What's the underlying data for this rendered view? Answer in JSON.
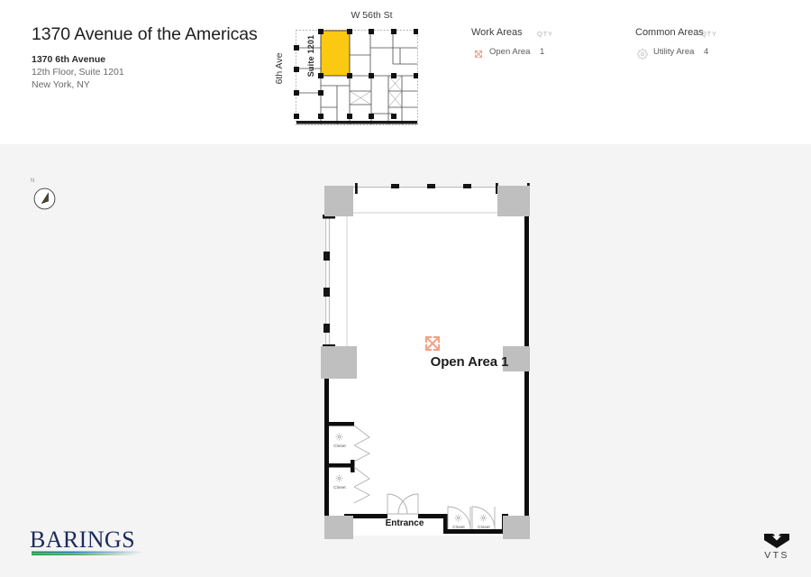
{
  "header": {
    "building_title": "1370 Avenue of the Americas",
    "address_line_1": "1370 6th Avenue",
    "address_line_2": "12th Floor, Suite 1201",
    "address_line_3": "New York, NY"
  },
  "key_plan": {
    "street_top_label": "W 56th St",
    "street_left_label": "6th Ave",
    "suite_label": "Suite 1201",
    "suite_highlight_color": "#fbc911"
  },
  "legend": {
    "work_areas": {
      "group_title": "Work Areas",
      "qty_header": "QTY",
      "rows": [
        {
          "icon": "open-area-icon",
          "label": "Open Area",
          "qty": "1"
        }
      ]
    },
    "common_areas": {
      "group_title": "Common Areas",
      "qty_header": "QTY",
      "rows": [
        {
          "icon": "gear-icon",
          "label": "Utility Area",
          "qty": "4"
        }
      ]
    }
  },
  "compass": {
    "north_label": "N",
    "needle_color": "#f2c029"
  },
  "floorplan": {
    "room_label": "Open Area 1",
    "entrance_label": "Entrance",
    "closet_labels": [
      "Closet",
      "Closet",
      "Closet",
      "Closet"
    ],
    "open_area_icon_color": "#f0a285",
    "column_fill": "#bfbfbf",
    "wall_color": "#000000"
  },
  "footer": {
    "barings_wordmark": "BARINGS",
    "vts_wordmark": "VTS"
  }
}
